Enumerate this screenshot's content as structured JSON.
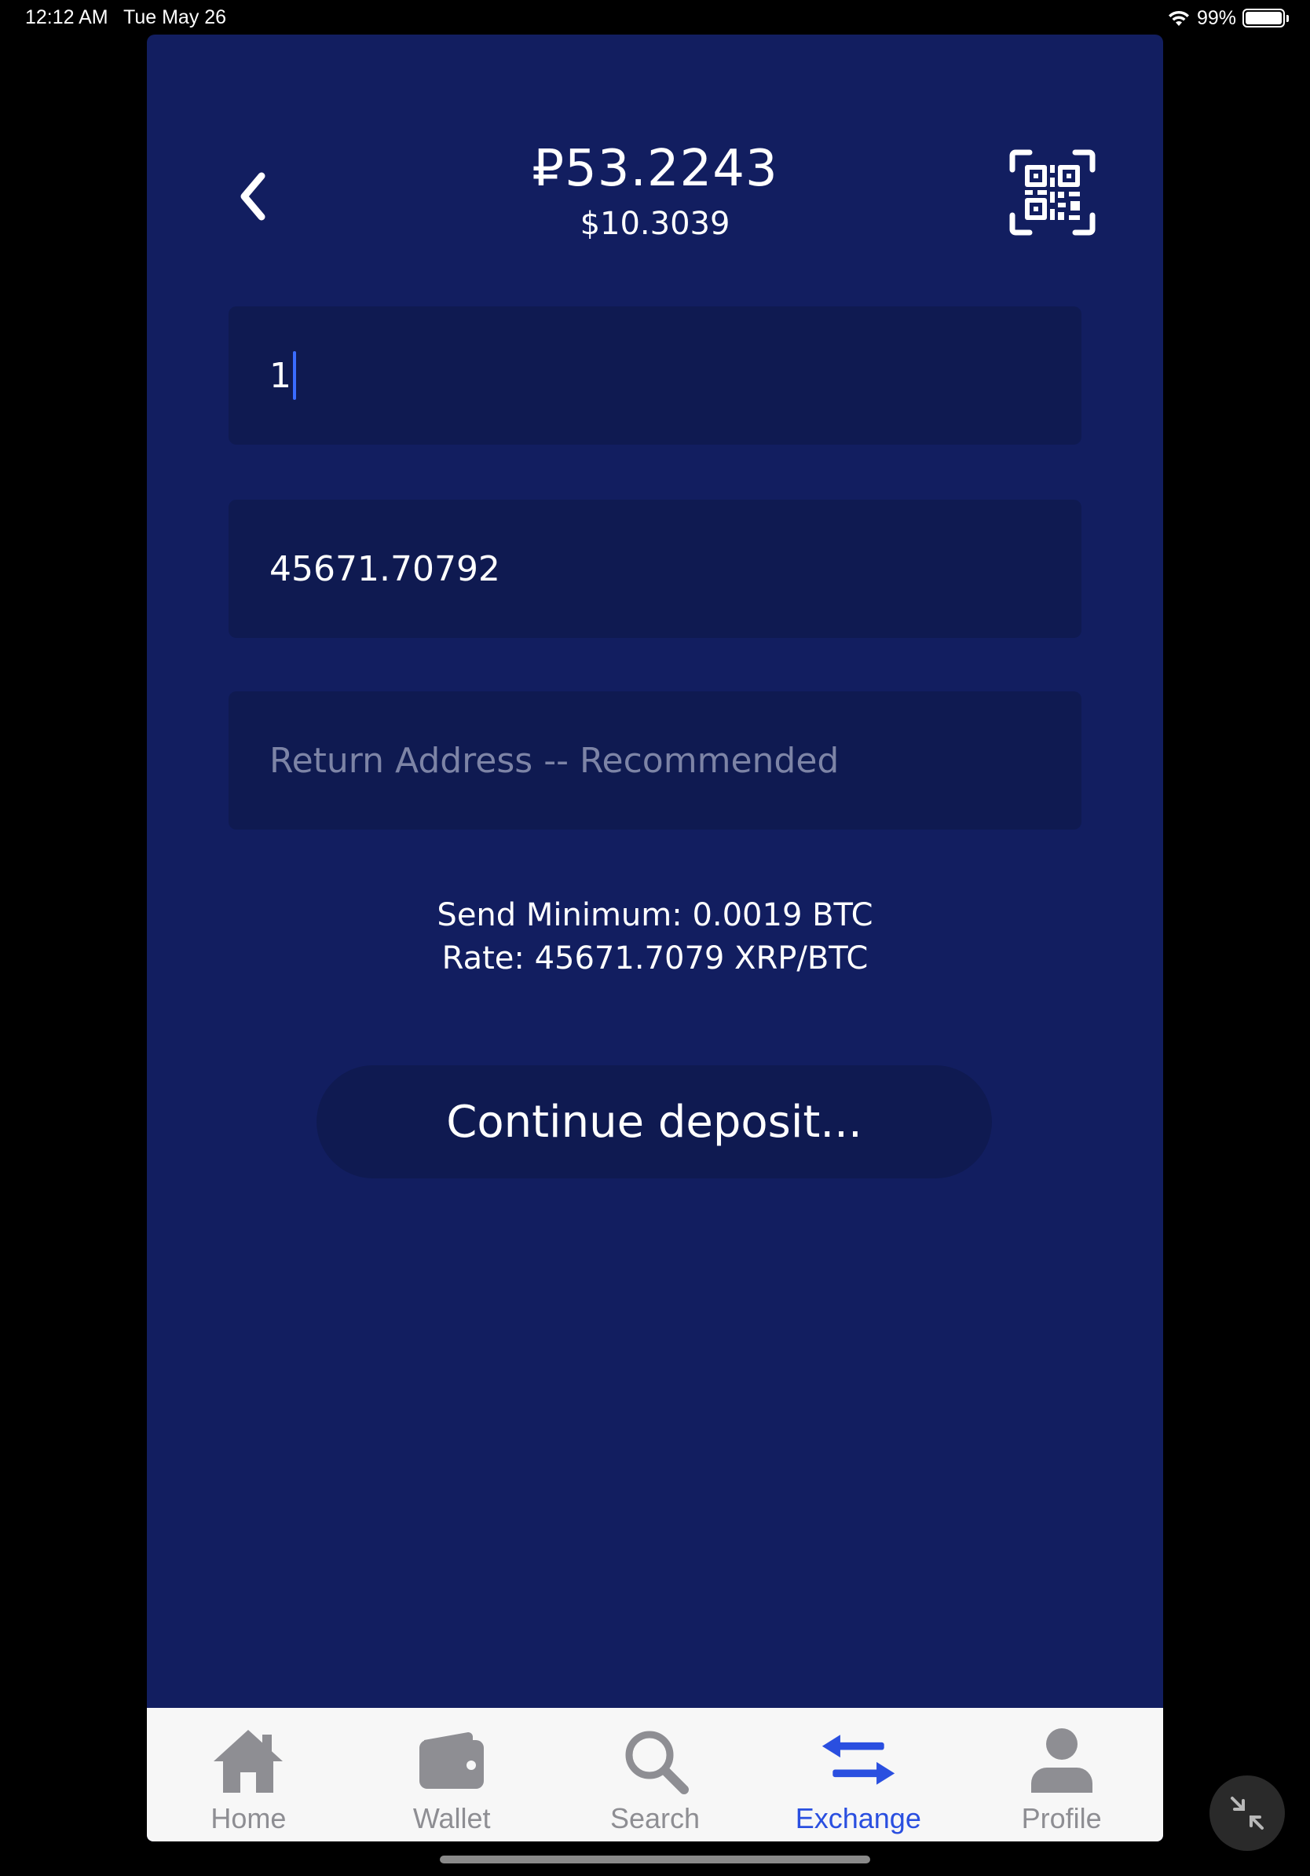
{
  "status_bar": {
    "time": "12:12 AM",
    "date": "Tue May 26",
    "battery": "99%"
  },
  "header": {
    "balance": "₽53.2243",
    "balance_usd": "$10.3039"
  },
  "form": {
    "amount_value": "1",
    "receive_value": "45671.70792",
    "return_address_placeholder": "Return Address -- Recommended"
  },
  "info": {
    "send_minimum": "Send Minimum: 0.0019 BTC",
    "rate": "Rate: 45671.7079 XRP/BTC"
  },
  "continue_label": "Continue deposit...",
  "tabs": [
    {
      "label": "Home",
      "icon": "home-icon",
      "active": false
    },
    {
      "label": "Wallet",
      "icon": "wallet-icon",
      "active": false
    },
    {
      "label": "Search",
      "icon": "search-icon",
      "active": false
    },
    {
      "label": "Exchange",
      "icon": "exchange-icon",
      "active": true
    },
    {
      "label": "Profile",
      "icon": "profile-icon",
      "active": false
    }
  ],
  "colors": {
    "background": "#121e60",
    "field": "#0f1a51",
    "tab_active": "#2a4fe0",
    "tab_inactive": "#8e8e93"
  }
}
